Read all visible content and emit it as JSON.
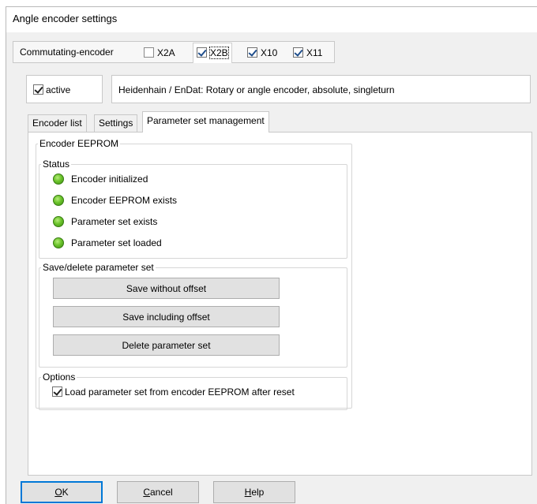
{
  "window": {
    "title": "Angle encoder settings"
  },
  "encoder_tabs": {
    "label": "Commutating-encoder",
    "items": [
      {
        "label": "X2A",
        "checked": false,
        "selected": false
      },
      {
        "label": "X2B",
        "checked": true,
        "selected": true
      },
      {
        "label": "X10",
        "checked": true,
        "selected": false
      },
      {
        "label": "X11",
        "checked": true,
        "selected": false
      }
    ]
  },
  "active": {
    "label": "active",
    "checked": true
  },
  "description": "Heidenhain / EnDat: Rotary or angle encoder, absolute, singleturn",
  "sub_tabs": [
    "Encoder list",
    "Settings",
    "Parameter set management"
  ],
  "eeprom": {
    "title": "Encoder EEPROM",
    "status": {
      "title": "Status",
      "items": [
        {
          "label": "Encoder initialized",
          "state": "green"
        },
        {
          "label": "Encoder EEPROM exists",
          "state": "green"
        },
        {
          "label": "Parameter set exists",
          "state": "green"
        },
        {
          "label": "Parameter set loaded",
          "state": "green"
        }
      ]
    },
    "save_delete": {
      "title": "Save/delete parameter set",
      "buttons": [
        "Save without offset",
        "Save including offset",
        "Delete parameter set"
      ]
    },
    "options": {
      "title": "Options",
      "load_after_reset": {
        "label": "Load parameter set from encoder EEPROM after reset",
        "checked": true
      }
    }
  },
  "footer": {
    "ok": {
      "prefix": "",
      "accel": "O",
      "rest": "K"
    },
    "cancel": {
      "prefix": "",
      "accel": "C",
      "rest": "ancel"
    },
    "help": {
      "prefix": "",
      "accel": "H",
      "rest": "elp"
    }
  },
  "colors": {
    "led_green": "#6cc42c",
    "focus_blue": "#0078d7"
  }
}
